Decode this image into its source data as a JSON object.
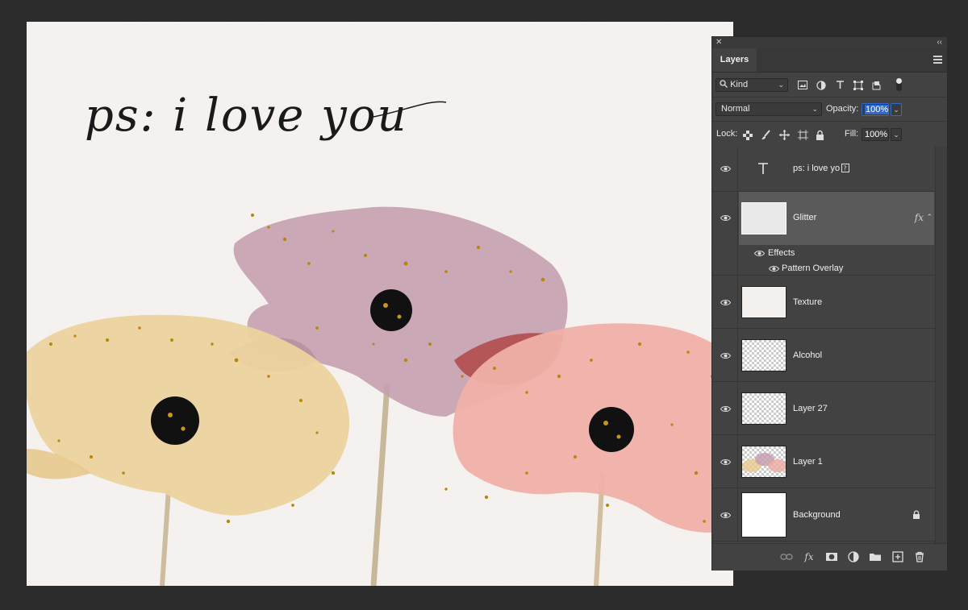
{
  "canvas": {
    "handwriting": "ps: i love you",
    "colors": {
      "paper": "#f5f1ef",
      "yellow_flower": "#e8c98f",
      "mauve_flower": "#c49aaa",
      "pink_flower": "#ecaaa3",
      "glitter": "#b8860b",
      "center": "#111111",
      "stem": "#c8b89a"
    }
  },
  "panel": {
    "tab": "Layers",
    "filter": {
      "kind_label": "Kind",
      "icons": [
        "image-filter-icon",
        "adjustment-filter-icon",
        "type-filter-icon",
        "shape-filter-icon",
        "smart-object-filter-icon",
        "filter-toggle-icon"
      ]
    },
    "blend_mode": "Normal",
    "opacity_label": "Opacity:",
    "opacity_value": "100%",
    "lock_label": "Lock:",
    "fill_label": "Fill:",
    "fill_value": "100%",
    "layers": [
      {
        "name": "ps: i love yo",
        "kind": "type",
        "visible": true
      },
      {
        "name": "Glitter",
        "kind": "pixel",
        "visible": true,
        "selected": true,
        "has_fx": true
      },
      {
        "name": "Effects",
        "kind": "effects-header",
        "visible": true
      },
      {
        "name": "Pattern Overlay",
        "kind": "effect",
        "visible": true
      },
      {
        "name": "Texture",
        "kind": "pixel",
        "visible": true
      },
      {
        "name": "Alcohol",
        "kind": "pixel",
        "visible": true
      },
      {
        "name": "Layer 27",
        "kind": "pixel",
        "visible": true
      },
      {
        "name": "Layer 1",
        "kind": "pixel",
        "visible": true
      },
      {
        "name": "Background",
        "kind": "background",
        "visible": true,
        "locked": true
      }
    ],
    "fx_label": "fx",
    "bottom_icons": [
      "link-layers-icon",
      "add-style-icon",
      "add-mask-icon",
      "new-adjustment-icon",
      "new-group-icon",
      "new-layer-icon",
      "delete-layer-icon"
    ]
  }
}
